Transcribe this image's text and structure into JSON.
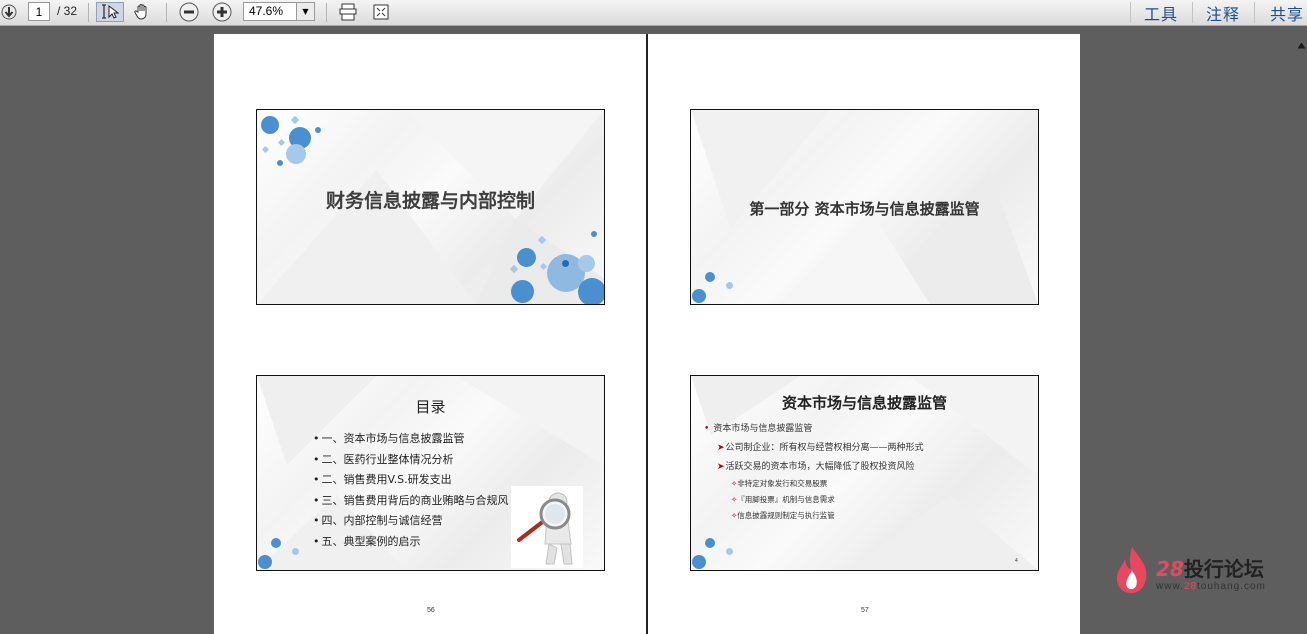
{
  "toolbar": {
    "page_current": "1",
    "page_total": "/ 32",
    "zoom_value": "47.6%",
    "right_links": {
      "tools": "工具",
      "comment": "注释",
      "share": "共享"
    }
  },
  "slides": {
    "s1": {
      "title": "财务信息披露与内部控制"
    },
    "s2": {
      "title": "第一部分 资本市场与信息披露监管"
    },
    "s3": {
      "title": "目录",
      "items": [
        "一、资本市场与信息披露监管",
        "二、医药行业整体情况分析",
        "二、销售费用V.S.研发支出",
        "三、销售费用背后的商业贿略与合规风",
        "四、内部控制与诚信经营",
        "五、典型案例的启示"
      ]
    },
    "s4": {
      "title": "资本市场与信息披露监管",
      "l1": "资本市场与信息披露监管",
      "l2a": "公司制企业：所有权与经营权相分离——两种形式",
      "l2b": "活跃交易的资本市场，大幅降低了股权投资风险",
      "l3": [
        "非特定对象发行和交易股票",
        "『用脚投票』机制与信息需求",
        "信息披露规则制定与执行监管"
      ],
      "corner_mark": "4"
    }
  },
  "page_numbers": {
    "left": "56",
    "right": "57"
  },
  "watermark": {
    "number": "28",
    "name": "投行论坛",
    "url_prefix": "www.",
    "url_red": "28",
    "url_suffix": "touhang.com"
  },
  "colors": {
    "accent_blue": "#4a8fd0",
    "light_blue": "#8fb9e0",
    "brand_red": "#e8475f",
    "arrow_red": "#c00000"
  }
}
